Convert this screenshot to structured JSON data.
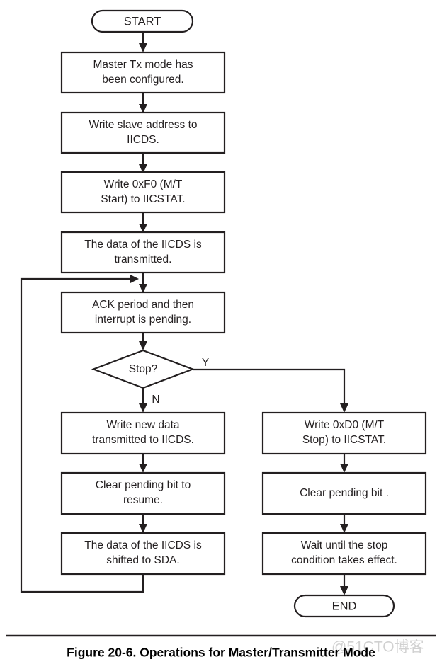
{
  "figure": {
    "caption": "Figure 20-6. Operations for Master/Transmitter Mode",
    "watermark": "@51CTO博客",
    "colors": {
      "stroke": "#231f20",
      "fill": "#ffffff",
      "caption": "#000000",
      "watermark": "#c9c9c9"
    }
  },
  "flowchart": {
    "type": "flowchart",
    "title": "Operations for Master/Transmitter Mode",
    "nodes": [
      {
        "id": "start",
        "shape": "terminator",
        "text": "START",
        "lines": [
          "START"
        ]
      },
      {
        "id": "l1",
        "shape": "process",
        "text": "Master Tx mode has been configured.",
        "lines": [
          "Master Tx mode has",
          "been configured."
        ]
      },
      {
        "id": "l2",
        "shape": "process",
        "text": "Write slave address to IICDS.",
        "lines": [
          "Write slave address to",
          "IICDS."
        ]
      },
      {
        "id": "l3",
        "shape": "process",
        "text": "Write 0xF0 (M/T Start) to IICSTAT.",
        "lines": [
          "Write 0xF0 (M/T",
          "Start) to IICSTAT."
        ]
      },
      {
        "id": "l4",
        "shape": "process",
        "text": "The data of the IICDS is transmitted.",
        "lines": [
          "The data of the IICDS is",
          "transmitted."
        ]
      },
      {
        "id": "l5",
        "shape": "process",
        "text": "ACK period and then interrupt is pending.",
        "lines": [
          "ACK period and then",
          "interrupt is pending."
        ]
      },
      {
        "id": "decision",
        "shape": "decision",
        "text": "Stop?",
        "lines": [
          "Stop?"
        ]
      },
      {
        "id": "n1",
        "shape": "process",
        "text": "Write new data transmitted to IICDS.",
        "lines": [
          "Write new data",
          "transmitted to IICDS."
        ]
      },
      {
        "id": "n2",
        "shape": "process",
        "text": "Clear pending bit to resume.",
        "lines": [
          "Clear pending bit to",
          "resume."
        ]
      },
      {
        "id": "n3",
        "shape": "process",
        "text": "The data of the IICDS is shifted to SDA.",
        "lines": [
          "The data of the IICDS is",
          "shifted to SDA."
        ]
      },
      {
        "id": "y1",
        "shape": "process",
        "text": "Write 0xD0 (M/T Stop) to IICSTAT.",
        "lines": [
          "Write 0xD0 (M/T",
          "Stop) to IICSTAT."
        ]
      },
      {
        "id": "y2",
        "shape": "process",
        "text": "Clear pending bit .",
        "lines": [
          "Clear pending bit ."
        ]
      },
      {
        "id": "y3",
        "shape": "process",
        "text": "Wait until the stop condition takes effect.",
        "lines": [
          "Wait until the stop",
          "condition takes effect."
        ]
      },
      {
        "id": "end",
        "shape": "terminator",
        "text": "END",
        "lines": [
          "END"
        ]
      }
    ],
    "edges": [
      {
        "from": "start",
        "to": "l1",
        "label": ""
      },
      {
        "from": "l1",
        "to": "l2",
        "label": ""
      },
      {
        "from": "l2",
        "to": "l3",
        "label": ""
      },
      {
        "from": "l3",
        "to": "l4",
        "label": ""
      },
      {
        "from": "l4",
        "to": "l5",
        "label": ""
      },
      {
        "from": "l5",
        "to": "decision",
        "label": ""
      },
      {
        "from": "decision",
        "to": "n1",
        "label": "N"
      },
      {
        "from": "decision",
        "to": "y1",
        "label": "Y"
      },
      {
        "from": "n1",
        "to": "n2",
        "label": ""
      },
      {
        "from": "n2",
        "to": "n3",
        "label": ""
      },
      {
        "from": "n3",
        "to": "l5",
        "label": ""
      },
      {
        "from": "y1",
        "to": "y2",
        "label": ""
      },
      {
        "from": "y2",
        "to": "y3",
        "label": ""
      },
      {
        "from": "y3",
        "to": "end",
        "label": ""
      }
    ],
    "branch_labels": {
      "yes": "Y",
      "no": "N"
    }
  }
}
